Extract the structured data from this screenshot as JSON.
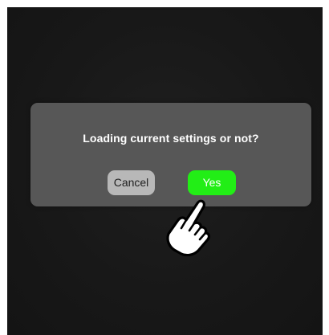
{
  "dialog": {
    "message": "Loading current settings or not?",
    "cancel_label": "Cancel",
    "yes_label": "Yes"
  },
  "colors": {
    "screen_bg": "#181818",
    "dialog_bg": "#575757",
    "cancel_bg": "#b8b8b8",
    "yes_bg": "#22ee16",
    "text": "#ffffff"
  },
  "icons": {
    "pointer": "pointing-hand-icon"
  }
}
